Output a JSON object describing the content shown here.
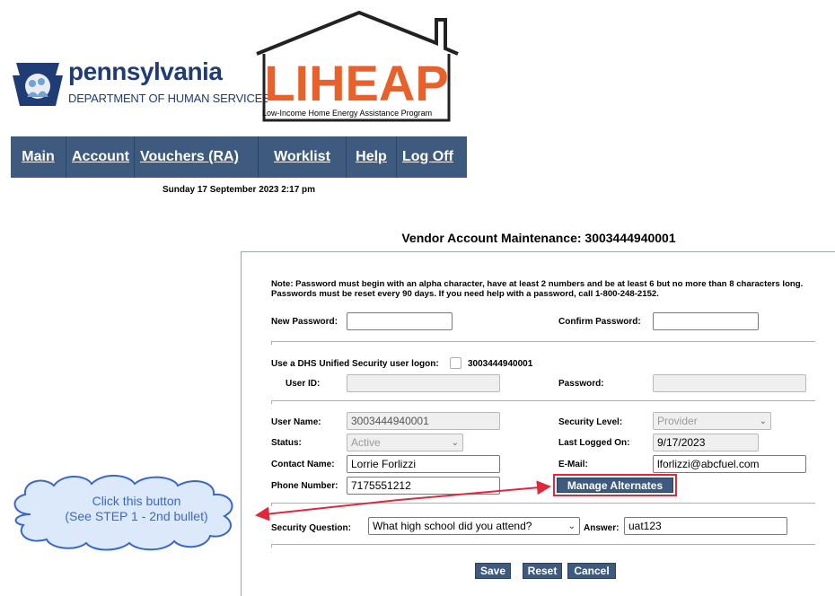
{
  "header": {
    "pa_word": "pennsylvania",
    "pa_dept": "DEPARTMENT OF HUMAN SERVICES",
    "liheap_logo": "LIHEAP",
    "liheap_subtitle": "Low-Income Home Energy Assistance Program"
  },
  "nav": {
    "items": [
      "Main",
      "Account",
      "Vouchers (RA)",
      "Worklist",
      "Help",
      "Log Off"
    ]
  },
  "date_line": "Sunday 17 September 2023 2:17 pm",
  "page_title": "Vendor Account Maintenance:  3003444940001",
  "note": "Note: Password must begin with an alpha character, have at least 2 numbers and be at least 6 but no more than 8 characters long. Passwords must be reset every 90 days. If you need help with a password, call 1-800-248-2152.",
  "password": {
    "new_label": "New Password:",
    "new_value": "",
    "confirm_label": "Confirm Password:",
    "confirm_value": ""
  },
  "unified": {
    "label": "Use a DHS Unified Security user logon:",
    "account": "3003444940001",
    "user_id_label": "User ID:",
    "user_id_value": "",
    "password_label": "Password:",
    "password_value": ""
  },
  "account": {
    "user_name_label": "User Name:",
    "user_name_value": "3003444940001",
    "security_level_label": "Security Level:",
    "security_level_value": "Provider",
    "status_label": "Status:",
    "status_value": "Active",
    "last_logged_label": "Last Logged On:",
    "last_logged_value": "9/17/2023",
    "contact_label": "Contact Name:",
    "contact_value": "Lorrie Forlizzi",
    "email_label": "E-Mail:",
    "email_value": "lforlizzi@abcfuel.com",
    "phone_label": "Phone Number:",
    "phone_value": "7175551212",
    "manage_alternates": "Manage Alternates"
  },
  "security": {
    "question_label": "Security Question:",
    "question_value": "What high school did you attend?",
    "answer_label": "Answer:",
    "answer_value": "uat123"
  },
  "actions": {
    "save": "Save",
    "reset": "Reset",
    "cancel": "Cancel"
  },
  "callout": {
    "line1": "Click this button",
    "line2": "(See STEP 1 - 2nd bullet)"
  },
  "colors": {
    "nav_bg": "#3e5a7e",
    "liheap_orange": "#e8602a",
    "highlight_red": "#e0283c",
    "callout_blue": "#3a68c9"
  }
}
